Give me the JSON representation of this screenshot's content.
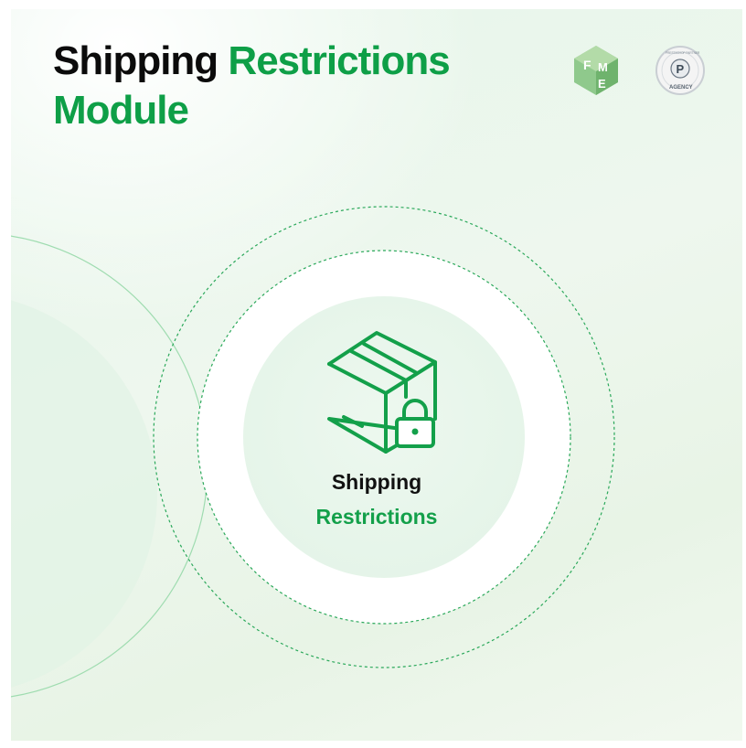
{
  "heading": {
    "line1_dark": "Shipping",
    "line1_green": "Restrictions",
    "line2_green": "Module"
  },
  "center": {
    "line1": "Shipping",
    "line2": "Restrictions"
  },
  "logos": {
    "fme": {
      "letters": "FME"
    },
    "badge": {
      "top_text": "PRESTASHOP PARTNER",
      "bottom_text": "AGENCY",
      "letter": "P"
    }
  },
  "icons": {
    "main": "package-lock-icon"
  },
  "colors": {
    "brand_green": "#0e9f47",
    "dark_text": "#0b0b0b",
    "line_green": "#14a14b"
  }
}
